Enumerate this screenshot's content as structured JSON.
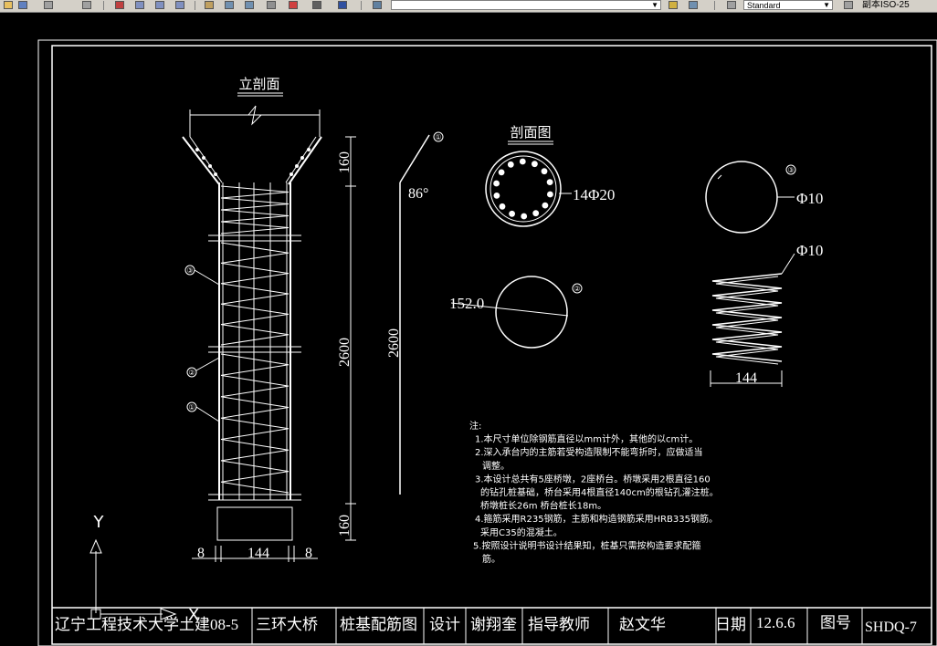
{
  "toolbar": {
    "layer_dropdown_value": "",
    "textstyle_value": "Standard",
    "dimstyle_label": "副本ISO-25",
    "icons": [
      "pan-icon",
      "undo-icon",
      "redo-icon",
      "zoom-realtime-icon",
      "zoom-window-icon",
      "zoom-previous-icon",
      "zoom-extents-icon",
      "properties-icon",
      "design-center-icon",
      "tool-palette-icon",
      "sheet-set-icon",
      "markup-icon",
      "calculator-icon",
      "help-icon",
      "layer-manager-icon",
      "layer-state-icon",
      "text-style-icon",
      "dim-style-icon"
    ]
  },
  "drawing": {
    "elevation_title": "立剖面",
    "section_title": "剖面图",
    "dims": {
      "top_height": "160",
      "main_length": "2600",
      "bottom_height": "160",
      "left_cover": "8",
      "width": "144",
      "right_cover": "8",
      "bar1_length": "2600",
      "bar1_angle": "86°",
      "main_bars": "14Φ20",
      "spiral_dia": "Φ10",
      "spiral_dia_2": "Φ10",
      "ring_dia": "152.0",
      "spiral_width": "144"
    },
    "markers": {
      "m1": "①",
      "m2": "②",
      "m3": "③"
    },
    "ucs": {
      "y": "Y",
      "x": "X"
    },
    "notes": [
      "注:",
      "1.本尺寸单位除钢筋直径以mm计外，其他的以cm计。",
      "2.深入承台内的主筋若受构造限制不能弯折时，应做适当",
      "调整。",
      "3.本设计总共有5座桥墩，2座桥台。桥墩采用2根直径160",
      "的钻孔桩基础，桥台采用4根直径140cm的根钻孔灌注桩。",
      "桥墩桩长26m 桥台桩长18m。",
      "4.箍筋采用R235钢筋，主筋和构造钢筋采用HRB335钢筋。",
      "采用C35的混凝土。",
      "5.按照设计说明书设计结果知，桩基只需按构造要求配箍",
      "筋。"
    ],
    "title_block": {
      "school": "辽宁工程技术大学土建08-5",
      "project": "三环大桥",
      "drawing_name": "桩基配筋图",
      "design_label": "设计",
      "designer": "谢翔奎",
      "advisor_label": "指导教师",
      "advisor": "赵文华",
      "date_label": "日期",
      "date": "12.6.6",
      "number_label": "图号",
      "number": "SHDQ-7"
    }
  }
}
